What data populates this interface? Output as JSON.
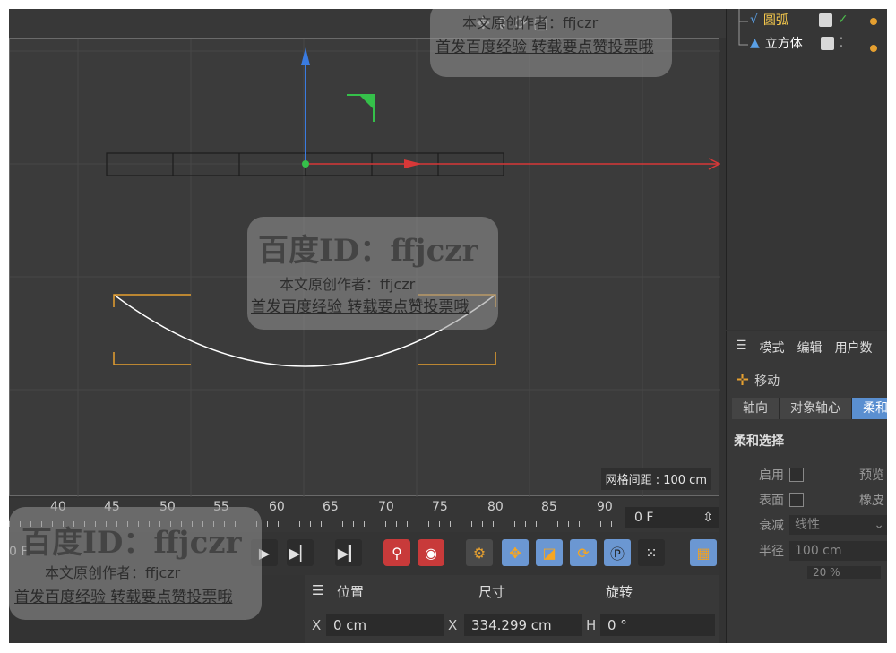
{
  "object_manager": {
    "items": [
      {
        "name": "圆弧",
        "icon": "spline-arc-icon",
        "color": "#f5c84c",
        "active": true
      },
      {
        "name": "立方体",
        "icon": "cube-icon",
        "color": "#ffffff",
        "active": false
      }
    ]
  },
  "attributes": {
    "menu": [
      "模式",
      "编辑",
      "用户数"
    ],
    "tool_name": "移动",
    "tabs": [
      "轴向",
      "对象轴心",
      "柔和"
    ],
    "section_title": "柔和选择",
    "rows": {
      "enable_label": "启用",
      "preview_label": "预览",
      "surface_label": "表面",
      "rubber_label": "橡皮",
      "falloff_label": "衰减",
      "falloff_value": "线性",
      "radius_label": "半径",
      "radius_value": "100 cm",
      "strength_value": "20 %"
    }
  },
  "viewport": {
    "grid_spacing_label": "网格间距 : 100 cm"
  },
  "timeline": {
    "ticks": [
      "40",
      "45",
      "50",
      "55",
      "60",
      "65",
      "70",
      "75",
      "80",
      "85",
      "90"
    ],
    "current_frame": "0 F",
    "left_frame": "0 F"
  },
  "coordinates": {
    "headers": {
      "position": "位置",
      "size": "尺寸",
      "rotation": "旋转"
    },
    "x_label": "X",
    "x2_label": "X",
    "h_label": "H",
    "position_x": "0 cm",
    "size_x": "334.299 cm",
    "rotation_h": "0 °"
  },
  "watermark": {
    "big": "百度ID：ffjczr",
    "author": "本文原创作者：ffjczr",
    "slogan": "首发百度经验 转载要点赞投票哦"
  },
  "colors": {
    "accent_blue": "#5a8fd0",
    "axis_x": "#e04040",
    "axis_y": "#3a7be0",
    "selection_orange": "#e6a030"
  }
}
